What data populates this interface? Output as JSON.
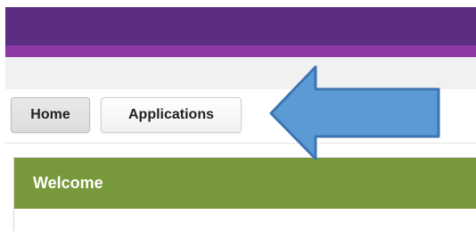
{
  "header": {
    "brand_color": "#5c2d82",
    "accent_color": "#8d3aa6"
  },
  "nav": {
    "home_label": "Home",
    "applications_label": "Applications"
  },
  "panel": {
    "title": "Welcome",
    "header_color": "#78993b"
  },
  "annotation": {
    "arrow_icon": "left-arrow-icon",
    "arrow_color": "#5b9bd5"
  }
}
